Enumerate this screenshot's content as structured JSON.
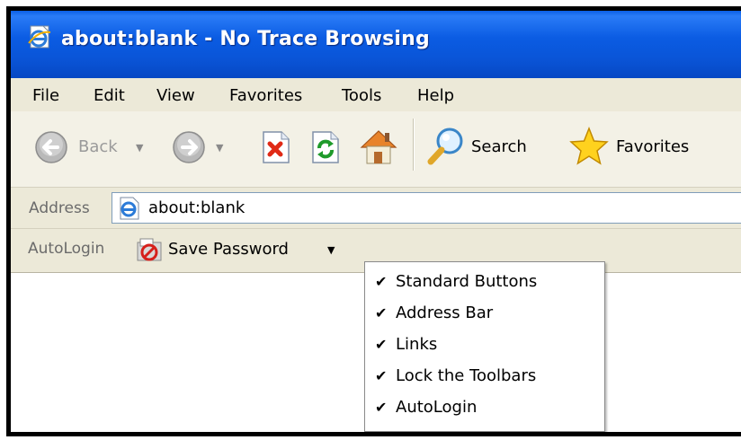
{
  "window": {
    "title": "about:blank - No Trace Browsing"
  },
  "menubar": {
    "items": [
      "File",
      "Edit",
      "View",
      "Favorites",
      "Tools",
      "Help"
    ]
  },
  "toolbar": {
    "back_label": "Back",
    "search_label": "Search",
    "favorites_label": "Favorites"
  },
  "address": {
    "label": "Address",
    "value": "about:blank"
  },
  "autologin": {
    "label": "AutoLogin",
    "save_password_label": "Save Password"
  },
  "context_menu": {
    "items": [
      {
        "label": "Standard Buttons",
        "checked": true
      },
      {
        "label": "Address Bar",
        "checked": true
      },
      {
        "label": "Links",
        "checked": true
      },
      {
        "label": "Lock the Toolbars",
        "checked": true
      },
      {
        "label": "AutoLogin",
        "checked": true
      }
    ]
  },
  "colors": {
    "titlebar": "#0a55d8",
    "menu_background": "#ece9d8"
  }
}
